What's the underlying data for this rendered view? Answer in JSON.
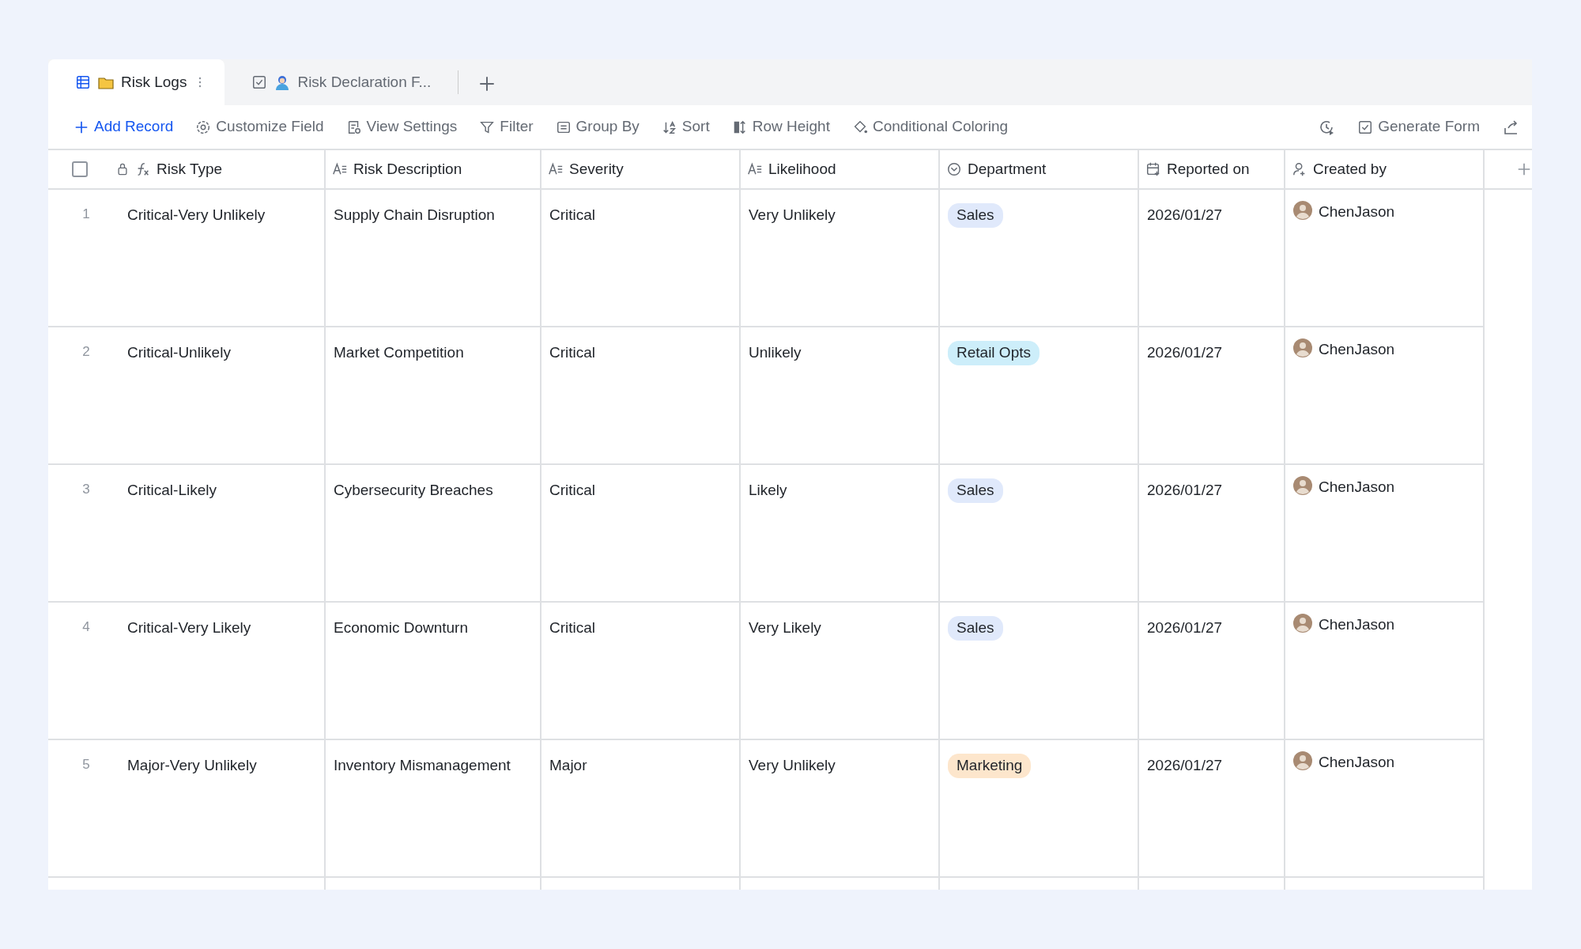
{
  "tabs": [
    {
      "label": "Risk Logs",
      "kind": "grid",
      "selected": true
    },
    {
      "label": "Risk Declaration F...",
      "kind": "form",
      "selected": false
    }
  ],
  "toolbar": {
    "primary": "Add Record",
    "items": [
      {
        "label": "Customize Field",
        "kind": "gear"
      },
      {
        "label": "View Settings",
        "kind": "settings"
      },
      {
        "label": "Filter",
        "kind": "filter"
      },
      {
        "label": "Group By",
        "kind": "group"
      },
      {
        "label": "Sort",
        "kind": "sort"
      },
      {
        "label": "Row Height",
        "kind": "height"
      },
      {
        "label": "Conditional Coloring",
        "kind": "coloring"
      }
    ],
    "right": "Generate Form"
  },
  "table": {
    "select_all_checked": false,
    "columns": [
      {
        "label": "Risk Type",
        "kind": "formula"
      },
      {
        "label": "Risk Description",
        "kind": "text"
      },
      {
        "label": "Severity",
        "kind": "text"
      },
      {
        "label": "Likelihood",
        "kind": "text"
      },
      {
        "label": "Department",
        "kind": "select"
      },
      {
        "label": "Reported on",
        "kind": "date"
      },
      {
        "label": "Created by",
        "kind": "user"
      }
    ],
    "rows": [
      {
        "number": "1",
        "risk_type": "Critical-Very Unlikely",
        "description": "Supply Chain Disruption",
        "severity": "Critical",
        "likelihood": "Very Unlikely",
        "department": "Sales",
        "color": "#e0e9fb",
        "reported_on": "2026/01/27",
        "created_by": "ChenJason"
      },
      {
        "number": "2",
        "risk_type": "Critical-Unlikely",
        "description": "Market Competition",
        "severity": "Critical",
        "likelihood": "Unlikely",
        "department": "Retail Opts",
        "color": "#cdeefa",
        "reported_on": "2026/01/27",
        "created_by": "ChenJason"
      },
      {
        "number": "3",
        "risk_type": "Critical-Likely",
        "description": "Cybersecurity Breaches",
        "severity": "Critical",
        "likelihood": "Likely",
        "department": "Sales",
        "color": "#e0e9fb",
        "reported_on": "2026/01/27",
        "created_by": "ChenJason"
      },
      {
        "number": "4",
        "risk_type": "Critical-Very Likely",
        "description": "Economic Downturn",
        "severity": "Critical",
        "likelihood": "Very Likely",
        "department": "Sales",
        "color": "#e0e9fb",
        "reported_on": "2026/01/27",
        "created_by": "ChenJason"
      },
      {
        "number": "5",
        "risk_type": "Major-Very Unlikely",
        "description": "Inventory Mismanagement",
        "severity": "Major",
        "likelihood": "Very Unlikely",
        "department": "Marketing",
        "color": "#fde6cc",
        "reported_on": "2026/01/27",
        "created_by": "ChenJason"
      }
    ]
  }
}
